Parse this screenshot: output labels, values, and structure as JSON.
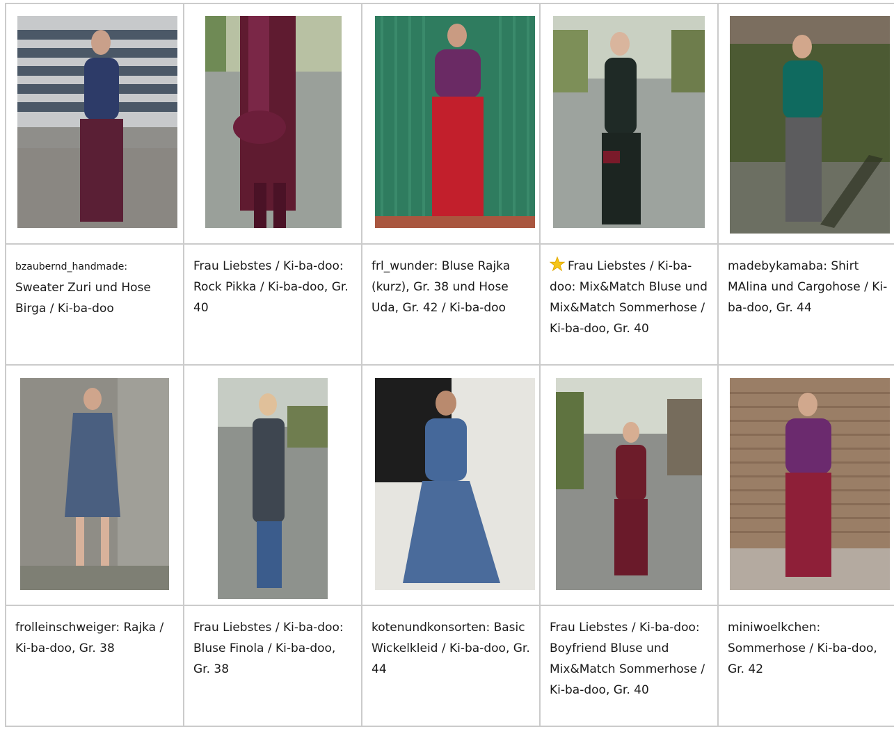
{
  "rows": [
    {
      "cells": [
        {
          "photo_alt": "Frau in blauem Pullover und weinroter Hose vor Gebäude",
          "caption_user": "bzaubernd_handmade:",
          "caption_text": "Sweater Zuri und Hose Birga / Ki-ba-doo"
        },
        {
          "photo_alt": "Rock und Tasche in Weinrot auf Straße",
          "caption_user": "",
          "caption_text": "Frau Liebstes / Ki-ba-doo: Rock Pikka / Ki-ba-doo, Gr. 40"
        },
        {
          "photo_alt": "Frau in lila Bluse und roter Hose vor grünem Tor",
          "caption_user": "",
          "caption_text": " frl_wunder: Bluse Rajka (kurz), Gr. 38 und Hose Uda, Gr. 42 / Ki-ba-doo"
        },
        {
          "photo_alt": "Frau in dunkelgrüner Bluse und Hose auf Straße",
          "caption_user": "",
          "caption_text": "Frau Liebstes / Ki-ba-doo: Mix&Match Bluse und Mix&Match Sommerhose / Ki-ba-doo, Gr. 40",
          "star": true
        },
        {
          "photo_alt": "Frau in grünem Shirt und grauer Cargohose",
          "caption_user": "",
          "caption_text": "madebykamaba: Shirt MAlina und Cargohose / Ki-ba-doo, Gr. 44"
        }
      ]
    },
    {
      "cells": [
        {
          "photo_alt": "Frau in blauem Kleid vor Betonwand",
          "caption_user": "",
          "caption_text": "frolleinschweiger: Rajka / Ki-ba-doo, Gr. 38"
        },
        {
          "photo_alt": "Frau in grauer Bluse und Jeans auf Straße",
          "caption_user": "",
          "caption_text": "Frau Liebstes / Ki-ba-doo: Bluse Finola / Ki-ba-doo, Gr. 38"
        },
        {
          "photo_alt": "Frau in blauem Wickelkleid vor weißer Wand",
          "caption_user": "",
          "caption_text": "kotenundkonsorten: Basic Wickelkleid / Ki-ba-doo, Gr. 44"
        },
        {
          "photo_alt": "Frau in weinrotem Outfit auf Straße",
          "caption_user": "",
          "caption_text": "Frau Liebstes / Ki-ba-doo: Boyfriend Bluse und Mix&Match Sommerhose / Ki-ba-doo, Gr. 40"
        },
        {
          "photo_alt": "Frau in lila Pullover und roter Hose vor Holzwand",
          "caption_user": "",
          "caption_text": " miniwoelkchen: Sommerhose / Ki-ba-doo, Gr. 42"
        }
      ]
    }
  ],
  "colors": {
    "grid_line": "#cbcbcb",
    "star": "#f5c518"
  }
}
